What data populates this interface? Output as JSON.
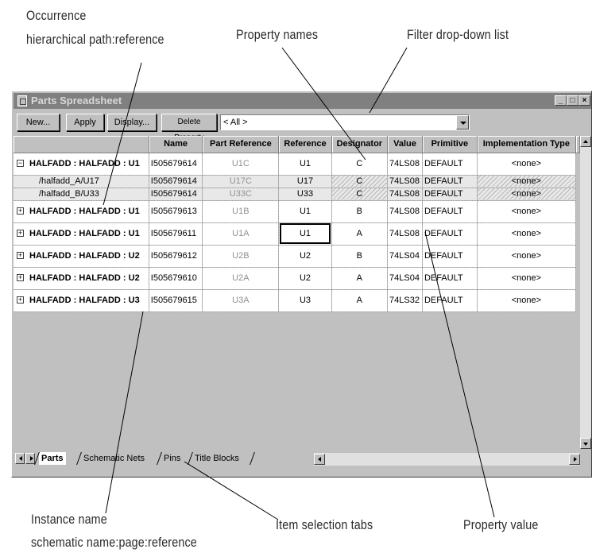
{
  "callouts": {
    "occurrence_title": "Occurrence",
    "occurrence_path": "hierarchical path:reference",
    "property_names": "Property names",
    "filter_list": "Filter drop-down list",
    "instance_name": "Instance name",
    "instance_path": "schematic name:page:reference",
    "item_tabs": "Item selection tabs",
    "property_value": "Property value"
  },
  "window": {
    "title": "Parts Spreadsheet",
    "minimize": "_",
    "maximize": "□",
    "close": "×"
  },
  "toolbar": {
    "new_label": "New...",
    "apply_label": "Apply",
    "display_label": "Display...",
    "delete_label": "Delete Property",
    "filter_value": "< All >"
  },
  "table": {
    "columns": [
      "Name",
      "Part Reference",
      "Reference",
      "Designator",
      "Value",
      "Primitive",
      "Implementation Type"
    ],
    "rows": [
      {
        "label": "HALFADD : HALFADD : U1",
        "expander": "−",
        "cells": [
          "I505679614",
          "U1C",
          "U1",
          "C",
          "74LS08",
          "DEFAULT",
          "<none>"
        ]
      },
      {
        "label": "/halfadd_A/U17",
        "cells": [
          "I505679614",
          "U17C",
          "U17",
          "C",
          "74LS08",
          "DEFAULT",
          "<none>"
        ]
      },
      {
        "label": "/halfadd_B/U33",
        "cells": [
          "I505679614",
          "U33C",
          "U33",
          "C",
          "74LS08",
          "DEFAULT",
          "<none>"
        ]
      },
      {
        "label": "HALFADD : HALFADD : U1",
        "expander": "+",
        "cells": [
          "I505679613",
          "U1B",
          "U1",
          "B",
          "74LS08",
          "DEFAULT",
          "<none>"
        ]
      },
      {
        "label": "HALFADD : HALFADD : U1",
        "expander": "+",
        "cells": [
          "I505679611",
          "U1A",
          "U1",
          "A",
          "74LS08",
          "DEFAULT",
          "<none>"
        ]
      },
      {
        "label": "HALFADD : HALFADD : U2",
        "expander": "+",
        "cells": [
          "I505679612",
          "U2B",
          "U2",
          "B",
          "74LS04",
          "DEFAULT",
          "<none>"
        ]
      },
      {
        "label": "HALFADD : HALFADD : U2",
        "expander": "+",
        "cells": [
          "I505679610",
          "U2A",
          "U2",
          "A",
          "74LS04",
          "DEFAULT",
          "<none>"
        ]
      },
      {
        "label": "HALFADD : HALFADD : U3",
        "expander": "+",
        "cells": [
          "I505679615",
          "U3A",
          "U3",
          "A",
          "74LS32",
          "DEFAULT",
          "<none>"
        ]
      }
    ]
  },
  "tabs": [
    "Parts",
    "Schematic Nets",
    "Pins",
    "Title Blocks"
  ]
}
